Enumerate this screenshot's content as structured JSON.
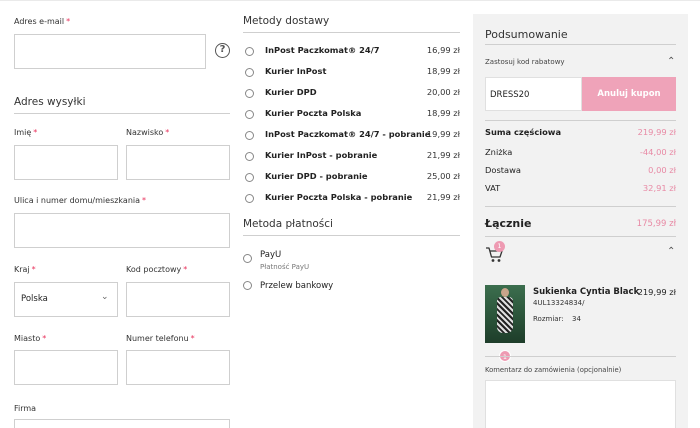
{
  "form": {
    "email_label": "Adres e-mail",
    "address_section_title": "Adres wysyłki",
    "first_name_label": "Imię",
    "last_name_label": "Nazwisko",
    "street_label": "Ulica i numer domu/mieszkania",
    "country_label": "Kraj",
    "country_value": "Polska",
    "postcode_label": "Kod pocztowy",
    "city_label": "Miasto",
    "phone_label": "Numer telefonu",
    "company_label": "Firma",
    "required_mark": "*",
    "help_glyph": "?",
    "select_chevron": "⌄"
  },
  "shipping": {
    "title": "Metody dostawy",
    "options": [
      {
        "name": "InPost Paczkomat® 24/7",
        "price": "16,99 zł"
      },
      {
        "name": "Kurier InPost",
        "price": "18,99 zł"
      },
      {
        "name": "Kurier DPD",
        "price": "20,00 zł"
      },
      {
        "name": "Kurier Poczta Polska",
        "price": "18,99 zł"
      },
      {
        "name": "InPost Paczkomat® 24/7 - pobranie",
        "price": "19,99 zł"
      },
      {
        "name": "Kurier InPost - pobranie",
        "price": "21,99 zł"
      },
      {
        "name": "Kurier DPD - pobranie",
        "price": "25,00 zł"
      },
      {
        "name": "Kurier Poczta Polska - pobranie",
        "price": "21,99 zł"
      }
    ]
  },
  "payment": {
    "title": "Metoda płatności",
    "options": [
      {
        "name": "PayU",
        "sub": "Płatność PayU"
      },
      {
        "name": "Przelew bankowy",
        "sub": ""
      }
    ]
  },
  "summary": {
    "title": "Podsumowanie",
    "discount_label": "Zastosuj kod rabatowy",
    "discount_code": "DRESS20",
    "cancel_label": "Anuluj kupon",
    "subtotal_label": "Suma częściowa",
    "subtotal_value": "219,99 zł",
    "discount_row_label": "Zniżka",
    "discount_row_value": "-44,00 zł",
    "shipping_label": "Dostawa",
    "shipping_value": "0,00 zł",
    "vat_label": "VAT",
    "vat_value": "32,91 zł",
    "total_label": "Łącznie",
    "total_value": "175,99 zł",
    "cart_count": "1",
    "chevron": "⌃",
    "product": {
      "name": "Sukienka Cyntia Black",
      "price": "219,99 zł",
      "sku": "4UL13324834/",
      "size_label": "Rozmiar:",
      "size_value": "34",
      "quantity": "1"
    },
    "comment_label": "Komentarz do zamówienia (opcjonalnie)"
  },
  "colors": {
    "accent": "#efa3b9",
    "price_pink": "#e88aa5",
    "required": "#e8315b",
    "panel_bg": "#f2f2f2"
  }
}
